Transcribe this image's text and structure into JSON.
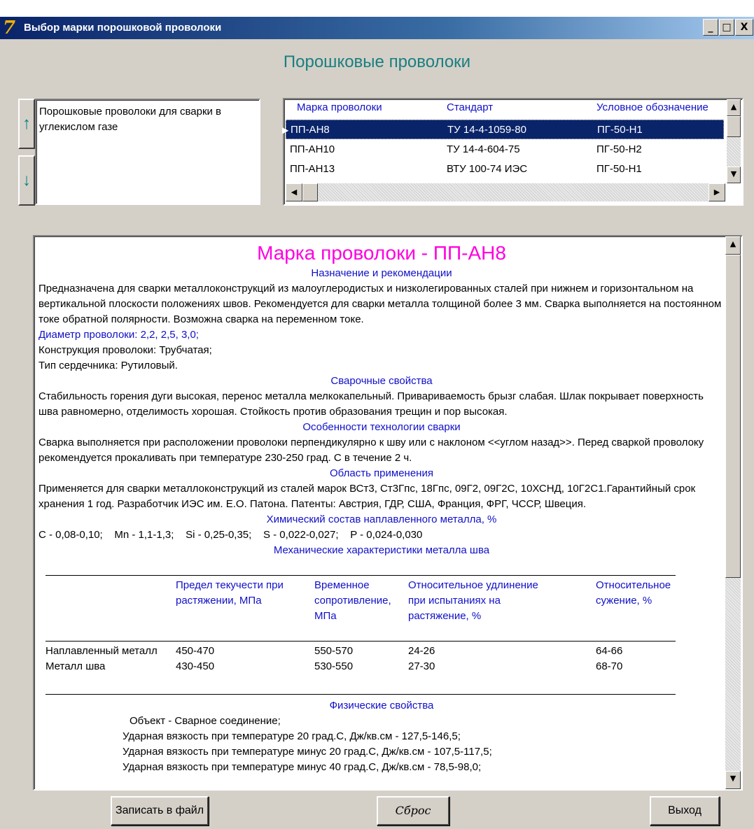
{
  "window": {
    "title": "Выбор марки  порошковой проволоки",
    "minimize": "_",
    "maximize": "□",
    "close": "X"
  },
  "heading": "Порошковые проволоки",
  "group": {
    "text": "Порошковые проволоки для сварки в углекислом газе",
    "up_icon": "arrow-up-icon",
    "down_icon": "arrow-down-icon"
  },
  "grid": {
    "columns": [
      "Марка проволоки",
      "Стандарт",
      "Условное обозначение"
    ],
    "rows": [
      {
        "mark": "ПП-АН8",
        "standard": "ТУ 14-4-1059-80",
        "designation": "ПГ-50-Н1"
      },
      {
        "mark": "ПП-АН10",
        "standard": "ТУ 14-4-604-75",
        "designation": "ПГ-50-Н2"
      },
      {
        "mark": "ПП-АН13",
        "standard": "ВТУ 100-74 ИЭС",
        "designation": "ПГ-50-Н1"
      }
    ],
    "selected_index": 0
  },
  "doc": {
    "title": "Марка проволоки - ПП-АН8",
    "sec_purpose": "Назначение и рекомендации",
    "purpose_text": "Предназначена для сварки металлоконструкций из малоуглеродистых и низколегированных сталей при нижнем и горизонтальном на вертикальной плоскости положениях швов. Рекомендуется для сварки металла толщиной более 3 мм. Сварка выполняется на постоянном токе обратной полярности. Возможна сварка на переменном токе.",
    "diameter": "Диаметр проволоки:  2,2, 2,5, 3,0;",
    "construction": "Конструкция проволоки:  Трубчатая;",
    "core": "Тип сердечника:  Рутиловый.",
    "sec_weld": "Сварочные свойства",
    "weld_text": "Стабильность горения дуги высокая, перенос металла мелкокапельный. Привариваемость брызг слабая. Шлак покрывает поверхность шва равномерно, отделимость хорошая. Стойкость против образования трещин и пор высокая.",
    "sec_tech": "Особенности технологии сварки",
    "tech_text": "Сварка выполняется при расположении проволоки перпендикулярно к шву или с наклоном <<углом назад>>. Перед сваркой проволоку рекомендуется прокаливать при температуре 230-250 град. С в течение 2 ч.",
    "sec_app": "Область применения",
    "app_text": "Применяется для сварки металлоконструкций из сталей марок ВСт3, Ст3Гпс, 18Гпс, 09Г2, 09Г2С, 10ХСНД, 10Г2С1.Гарантийный срок хранения 1 год. Разработчик ИЭС им. Е.О. Патона. Патенты: Австрия, ГДР, США, Франция, ФРГ, ЧССР, Швеция.",
    "sec_chem": "Химический состав наплавленного металла, %",
    "chem_text": "С - 0,08-0,10;    Mn - 1,1-1,3;    Si - 0,25-0,35;    S - 0,022-0,027;    P - 0,024-0,030",
    "sec_mech": "Механические характеристики металла шва",
    "mech_headers": [
      "Предел текучести при растяжении, МПа",
      "Временное сопротивление, МПа",
      "Относительное удлинение при испытаниях на растяжение, %",
      "Относительное сужение, %"
    ],
    "mech_rows": [
      {
        "name": "Наплавленный металл",
        "yield": "450-470",
        "tensile": "550-570",
        "elong": "24-26",
        "narrow": "64-66"
      },
      {
        "name": "Металл шва",
        "yield": "430-450",
        "tensile": "530-550",
        "elong": "27-30",
        "narrow": "68-70"
      }
    ],
    "sec_phys": "Физические свойства",
    "phys_object": "Объект - Сварное соединение;",
    "phys_lines": [
      "Ударная вязкость при температуре 20 град.С, Дж/кв.см - 127,5-146,5;",
      "Ударная вязкость при температуре минус 20 град.С, Дж/кв.см - 107,5-117,5;",
      "Ударная вязкость при температуре минус 40 град.С, Дж/кв.см - 78,5-98,0;"
    ]
  },
  "buttons": {
    "save": "Записать в файл",
    "reset": "Сброс",
    "exit": "Выход"
  }
}
